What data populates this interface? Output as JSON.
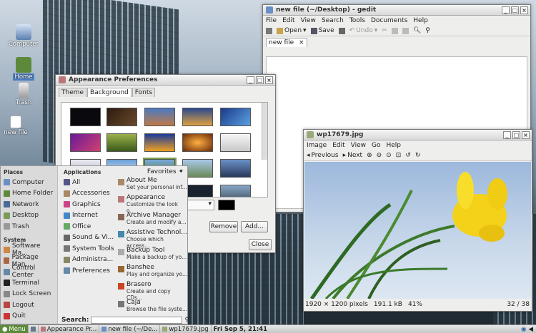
{
  "desktop": {
    "icons": [
      {
        "label": "Computer",
        "icon": "computer-icon"
      },
      {
        "label": "Home",
        "icon": "home-folder-icon"
      },
      {
        "label": "Trash",
        "icon": "trash-icon"
      },
      {
        "label": "new file",
        "icon": "text-file-icon"
      }
    ]
  },
  "gedit": {
    "title": "new file (~/Desktop) - gedit",
    "menu": [
      "File",
      "Edit",
      "View",
      "Search",
      "Tools",
      "Documents",
      "Help"
    ],
    "toolbar": {
      "open": "Open",
      "save": "Save",
      "undo": "Undo"
    },
    "tab_label": "new file",
    "tab_close": "×"
  },
  "appearance": {
    "title": "Appearance Preferences",
    "tabs": [
      "Theme",
      "Background",
      "Fonts"
    ],
    "remove": "Remove",
    "add": "Add...",
    "close": "Close"
  },
  "viewer": {
    "title": "wp17679.jpg",
    "menu": [
      "Image",
      "Edit",
      "View",
      "Go",
      "Help"
    ],
    "previous": "Previous",
    "next": "Next",
    "status": {
      "dimensions": "1920 × 1200 pixels",
      "size": "191.1 kB",
      "zoom": "41%",
      "position": "32 / 38"
    }
  },
  "startmenu": {
    "places_header": "Places",
    "places": [
      "Computer",
      "Home Folder",
      "Network",
      "Desktop",
      "Trash"
    ],
    "system_header": "System",
    "system": [
      "Software Ma...",
      "Package Man...",
      "Control Center",
      "Terminal",
      "Lock Screen",
      "Logout",
      "Quit"
    ],
    "applications_header": "Applications",
    "applications": [
      "All",
      "Accessories",
      "Graphics",
      "Internet",
      "Office",
      "Sound & Vi...",
      "System Tools",
      "Administra...",
      "Preferences"
    ],
    "favorites_header": "Favorites",
    "favorites": [
      {
        "name": "About Me",
        "desc": "Set your personal inf..."
      },
      {
        "name": "Appearance",
        "desc": "Customize the look o..."
      },
      {
        "name": "Archive Manager",
        "desc": "Create and modify a..."
      },
      {
        "name": "Assistive Technol...",
        "desc": "Choose which access..."
      },
      {
        "name": "Backup Tool",
        "desc": "Make a backup of yo..."
      },
      {
        "name": "Banshee",
        "desc": "Play and organize yo..."
      },
      {
        "name": "Brasero",
        "desc": "Create and copy CDs..."
      },
      {
        "name": "Caja",
        "desc": "Browse the file syste..."
      }
    ],
    "search_label": "Search:"
  },
  "taskbar": {
    "menu": "Menu",
    "tasks": [
      "Appearance Pr...",
      "new file (~/De...",
      "wp17679.jpg"
    ],
    "clock": "Fri Sep  5, 21:41"
  }
}
